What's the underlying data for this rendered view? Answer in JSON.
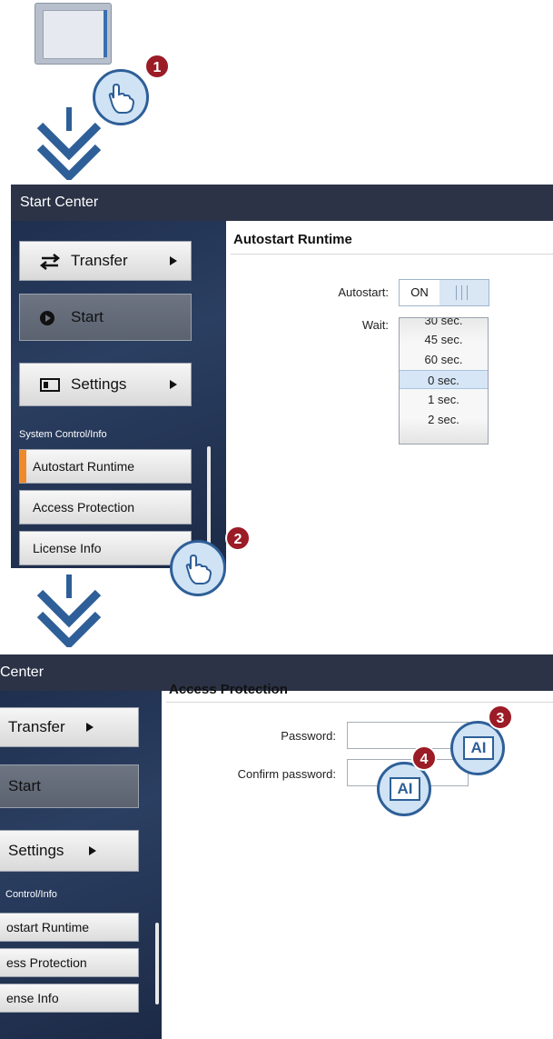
{
  "steps": [
    "1",
    "2",
    "3",
    "4"
  ],
  "panel1": {
    "title": "Start Center",
    "sidebar": {
      "transfer": "Transfer",
      "start": "Start",
      "settings": "Settings",
      "section": "System Control/Info",
      "items": [
        "Autostart Runtime",
        "Access Protection",
        "License Info"
      ],
      "active_item": "Autostart Runtime"
    },
    "content": {
      "heading": "Autostart Runtime",
      "autostart_label": "Autostart:",
      "toggle_state": "ON",
      "wait_label": "Wait:",
      "wait_options": [
        "30 sec.",
        "45 sec.",
        "60 sec.",
        "0 sec.",
        "1 sec.",
        "2 sec."
      ],
      "wait_selected": "0 sec."
    }
  },
  "panel2": {
    "title": "Center",
    "sidebar": {
      "transfer": "Transfer",
      "start": "Start",
      "settings": "Settings",
      "section": "Control/Info",
      "items": [
        "ostart Runtime",
        "ess Protection",
        "ense Info"
      ]
    },
    "content": {
      "heading": "Access Protection",
      "password_label": "Password:",
      "confirm_label": "Confirm password:",
      "password_value": "",
      "confirm_value": "",
      "text_input_icon": "AI"
    }
  },
  "colors": {
    "titlebar": "#2c3347",
    "accent": "#ef8a2a",
    "badge": "#9b1b26",
    "arrow": "#2e5f98"
  }
}
